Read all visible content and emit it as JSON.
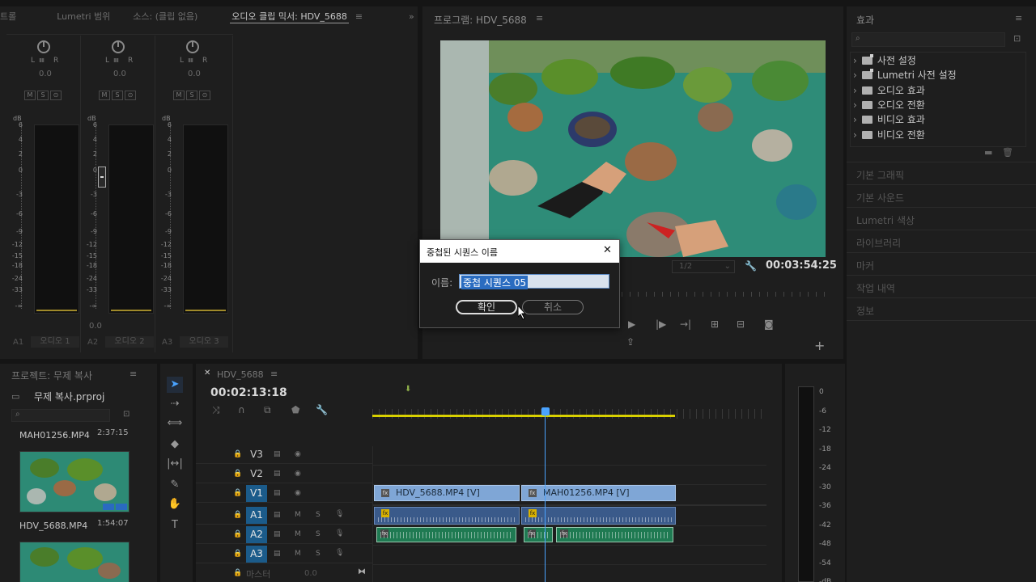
{
  "mixer_panel": {
    "tabs": [
      "트롤",
      "Lumetri 범위",
      "소스: (클립 없음)",
      "오디오 클립 믹서: HDV_5688"
    ],
    "expand_icon": "»",
    "channels": [
      {
        "id": "A1",
        "name": "오디오 1",
        "pan_left": "L",
        "pan_right": "R",
        "pan_value": "0.0"
      },
      {
        "id": "A2",
        "name": "오디오 2",
        "pan_left": "L",
        "pan_right": "R",
        "pan_value": "0.0",
        "fader_value": "0.0"
      },
      {
        "id": "A3",
        "name": "오디오 3",
        "pan_left": "L",
        "pan_right": "R",
        "pan_value": "0.0"
      }
    ],
    "mute_label": "M",
    "solo_label": "S",
    "record_label": "⊙",
    "db_label": "dB",
    "db_scale": [
      "6",
      "4",
      "2",
      "0",
      "-3",
      "-6",
      "-9",
      "-12",
      "-15",
      "-18",
      "-24",
      "-33",
      "-∞"
    ]
  },
  "program_panel": {
    "title": "프로그램: HDV_5688",
    "resolution": "1/2",
    "timecode": "00:03:54:25",
    "add_icon": "+"
  },
  "dialog": {
    "title": "중첩된 시퀀스 이름",
    "close_icon": "✕",
    "name_label": "이름:",
    "name_value": "중첩 시퀀스 05",
    "ok_label": "확인",
    "cancel_label": "취소"
  },
  "effects_panel": {
    "title": "효과",
    "items": [
      "사전 설정",
      "Lumetri 사전 설정",
      "오디오 효과",
      "오디오 전환",
      "비디오 효과",
      "비디오 전환"
    ],
    "sections": [
      "기본 그래픽",
      "기본 사운드",
      "Lumetri 색상",
      "라이브러리",
      "마커",
      "작업 내역",
      "정보"
    ]
  },
  "project_panel": {
    "title": "프로젝트: 무제 복사",
    "filename": "무제 복사.prproj",
    "items": [
      {
        "name": "MAH01256.MP4",
        "duration": "2:37:15"
      },
      {
        "name": "HDV_5688.MP4",
        "duration": "1:54:07"
      }
    ]
  },
  "timeline_panel": {
    "tab": "HDV_5688",
    "timecode": "00:02:13:18",
    "tracks": [
      {
        "id": "V3"
      },
      {
        "id": "V2"
      },
      {
        "id": "V1"
      },
      {
        "id": "A1"
      },
      {
        "id": "A2"
      },
      {
        "id": "A3"
      }
    ],
    "master_label": "마스터",
    "master_value": "0.0",
    "clips": {
      "v1_clip1": "HDV_5688.MP4 [V]",
      "v1_clip2": "MAH01256.MP4 [V]",
      "fx_label": "fx"
    },
    "track_m": "M",
    "track_s": "S"
  },
  "audio_meter": {
    "scale": [
      "0",
      "-6",
      "-12",
      "-18",
      "-24",
      "-30",
      "-36",
      "-42",
      "-48",
      "-54",
      "-dB"
    ]
  },
  "colors": {
    "accent": "#1b5b8a",
    "playhead": "#4aa3ff",
    "video_clip": "#7fa6d6",
    "audio_clip": "#1f7a52",
    "work_area": "#d8d000"
  }
}
